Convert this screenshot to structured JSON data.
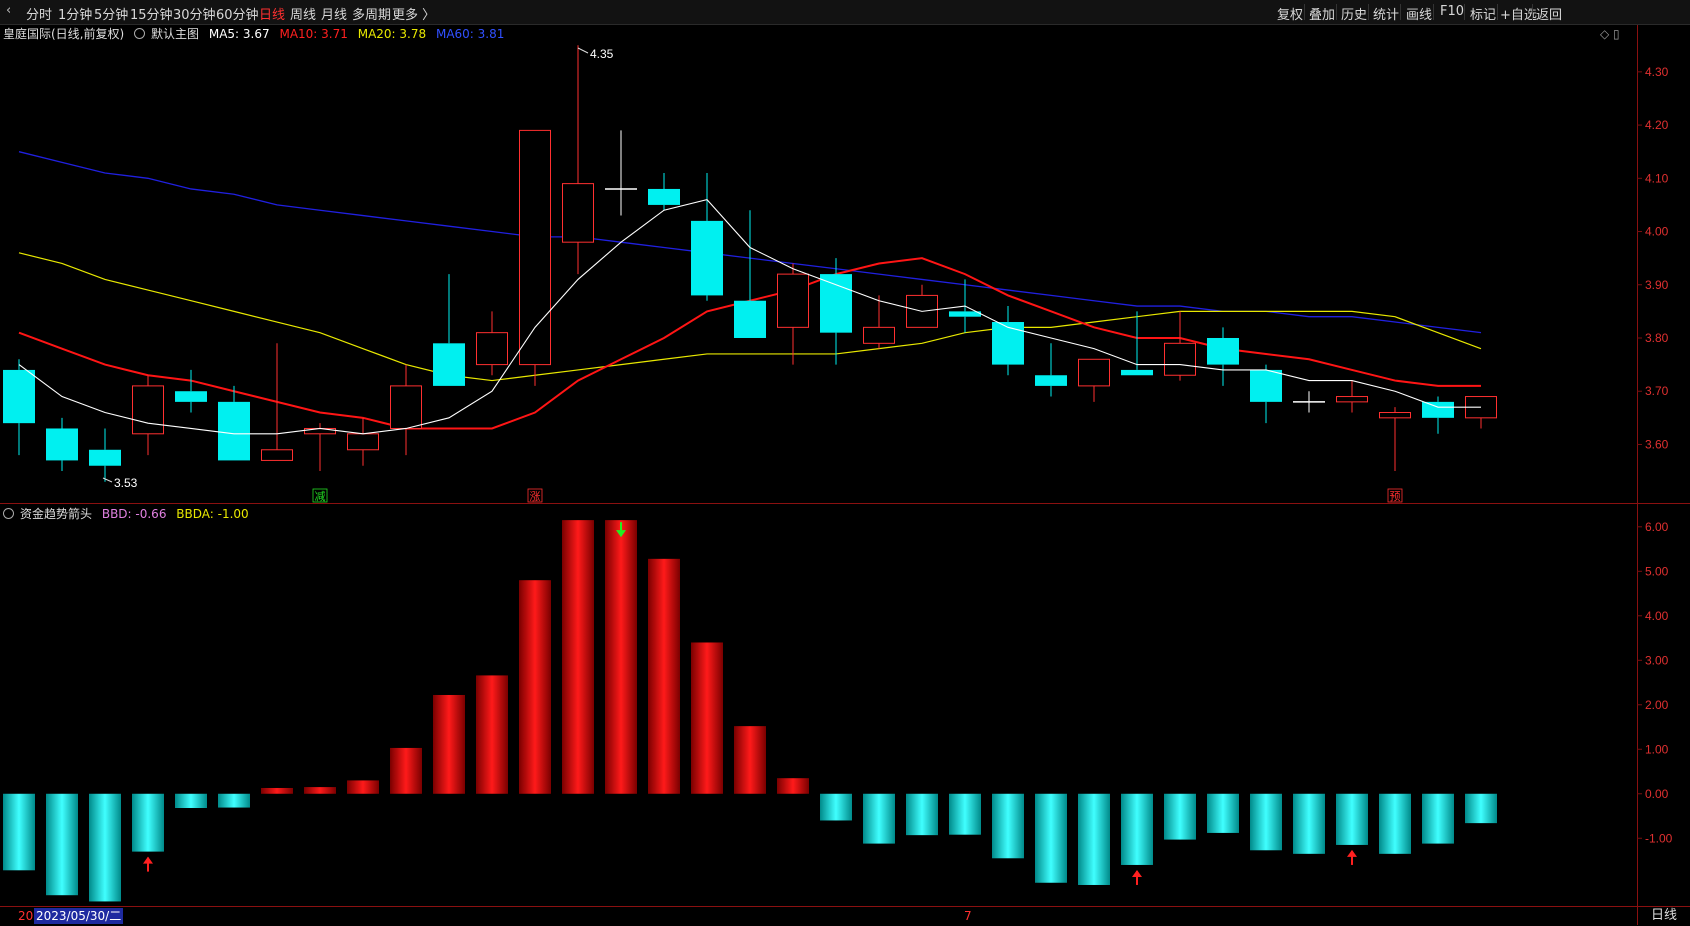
{
  "toolbar": {
    "left": [
      "分时",
      "1分钟",
      "5分钟",
      "15分钟",
      "30分钟",
      "60分钟",
      "日线",
      "周线",
      "月线",
      "多周期",
      "更多 〉"
    ],
    "active_index": 6,
    "right": [
      "复权",
      "叠加",
      "历史",
      "统计",
      "画线",
      "F10",
      "标记",
      "+自选",
      "返回"
    ]
  },
  "main_legend": {
    "title": "皇庭国际(日线,前复权)",
    "template": "默认主图",
    "ma5": "MA5: 3.67",
    "ma10": "MA10: 3.71",
    "ma20": "MA20: 3.78",
    "ma60": "MA60: 3.81"
  },
  "window_icons": "◇ ▯",
  "sub_legend": {
    "name": "资金趋势箭头",
    "bbd": "BBD: -0.66",
    "bbda": "BBDA: -1.00"
  },
  "price_axis": {
    "ticks": [
      "4.30",
      "4.20",
      "4.10",
      "4.00",
      "3.90",
      "3.80",
      "3.70",
      "3.60"
    ],
    "values": [
      4.3,
      4.2,
      4.1,
      4.0,
      3.9,
      3.8,
      3.7,
      3.6
    ],
    "min": 3.49,
    "max": 4.388
  },
  "bbd_axis": {
    "ticks": [
      "6.00",
      "5.00",
      "4.00",
      "3.00",
      "2.00",
      "1.00",
      "0.00",
      "-1.00"
    ],
    "values": [
      6,
      5,
      4,
      3,
      2,
      1,
      0,
      -1
    ],
    "min": -2.5,
    "max": 6.49
  },
  "annotations": {
    "high": "4.35",
    "low": "3.53"
  },
  "signals": [
    {
      "label": "减",
      "index": 7,
      "color": "#22dd22"
    },
    {
      "label": "涨",
      "index": 12,
      "color": "#ff3030"
    },
    {
      "label": "预",
      "index": 32,
      "color": "#ff3030"
    }
  ],
  "chart_data": {
    "type": "candlestick",
    "candles": [
      {
        "o": 3.74,
        "h": 3.76,
        "l": 3.58,
        "c": 3.64
      },
      {
        "o": 3.63,
        "h": 3.65,
        "l": 3.55,
        "c": 3.57
      },
      {
        "o": 3.59,
        "h": 3.63,
        "l": 3.53,
        "c": 3.56
      },
      {
        "o": 3.62,
        "h": 3.73,
        "l": 3.58,
        "c": 3.71
      },
      {
        "o": 3.7,
        "h": 3.74,
        "l": 3.66,
        "c": 3.68
      },
      {
        "o": 3.68,
        "h": 3.71,
        "l": 3.57,
        "c": 3.57
      },
      {
        "o": 3.57,
        "h": 3.79,
        "l": 3.57,
        "c": 3.59
      },
      {
        "o": 3.62,
        "h": 3.64,
        "l": 3.55,
        "c": 3.63
      },
      {
        "o": 3.59,
        "h": 3.65,
        "l": 3.56,
        "c": 3.62
      },
      {
        "o": 3.63,
        "h": 3.75,
        "l": 3.58,
        "c": 3.71
      },
      {
        "o": 3.79,
        "h": 3.92,
        "l": 3.71,
        "c": 3.71
      },
      {
        "o": 3.75,
        "h": 3.85,
        "l": 3.73,
        "c": 3.81
      },
      {
        "o": 3.75,
        "h": 4.19,
        "l": 3.71,
        "c": 4.19
      },
      {
        "o": 3.98,
        "h": 4.35,
        "l": 3.92,
        "c": 4.09
      },
      {
        "o": 4.08,
        "h": 4.19,
        "l": 4.03,
        "c": 4.08
      },
      {
        "o": 4.08,
        "h": 4.11,
        "l": 4.04,
        "c": 4.05
      },
      {
        "o": 4.02,
        "h": 4.11,
        "l": 3.87,
        "c": 3.88
      },
      {
        "o": 3.87,
        "h": 4.04,
        "l": 3.8,
        "c": 3.8
      },
      {
        "o": 3.82,
        "h": 3.94,
        "l": 3.75,
        "c": 3.92
      },
      {
        "o": 3.92,
        "h": 3.95,
        "l": 3.75,
        "c": 3.81
      },
      {
        "o": 3.79,
        "h": 3.88,
        "l": 3.78,
        "c": 3.82
      },
      {
        "o": 3.82,
        "h": 3.9,
        "l": 3.82,
        "c": 3.88
      },
      {
        "o": 3.85,
        "h": 3.91,
        "l": 3.81,
        "c": 3.84
      },
      {
        "o": 3.83,
        "h": 3.86,
        "l": 3.73,
        "c": 3.75
      },
      {
        "o": 3.73,
        "h": 3.79,
        "l": 3.69,
        "c": 3.71
      },
      {
        "o": 3.71,
        "h": 3.76,
        "l": 3.68,
        "c": 3.76
      },
      {
        "o": 3.74,
        "h": 3.85,
        "l": 3.73,
        "c": 3.73
      },
      {
        "o": 3.73,
        "h": 3.85,
        "l": 3.72,
        "c": 3.79
      },
      {
        "o": 3.8,
        "h": 3.82,
        "l": 3.71,
        "c": 3.75
      },
      {
        "o": 3.74,
        "h": 3.75,
        "l": 3.64,
        "c": 3.68
      },
      {
        "o": 3.68,
        "h": 3.7,
        "l": 3.66,
        "c": 3.68
      },
      {
        "o": 3.68,
        "h": 3.72,
        "l": 3.66,
        "c": 3.69
      },
      {
        "o": 3.65,
        "h": 3.67,
        "l": 3.55,
        "c": 3.66
      },
      {
        "o": 3.68,
        "h": 3.69,
        "l": 3.62,
        "c": 3.65
      },
      {
        "o": 3.65,
        "h": 3.69,
        "l": 3.63,
        "c": 3.69
      }
    ],
    "ma5": [
      3.75,
      3.69,
      3.66,
      3.64,
      3.63,
      3.62,
      3.62,
      3.63,
      3.62,
      3.63,
      3.65,
      3.7,
      3.82,
      3.91,
      3.98,
      4.04,
      4.06,
      3.97,
      3.93,
      3.9,
      3.87,
      3.85,
      3.86,
      3.82,
      3.8,
      3.78,
      3.75,
      3.75,
      3.74,
      3.74,
      3.72,
      3.72,
      3.7,
      3.67,
      3.67
    ],
    "ma10": [
      3.81,
      3.78,
      3.75,
      3.73,
      3.72,
      3.7,
      3.68,
      3.66,
      3.65,
      3.63,
      3.63,
      3.63,
      3.66,
      3.72,
      3.76,
      3.8,
      3.85,
      3.87,
      3.89,
      3.92,
      3.94,
      3.95,
      3.92,
      3.88,
      3.85,
      3.82,
      3.8,
      3.8,
      3.78,
      3.77,
      3.76,
      3.74,
      3.72,
      3.71,
      3.71
    ],
    "ma20": [
      3.96,
      3.94,
      3.91,
      3.89,
      3.87,
      3.85,
      3.83,
      3.81,
      3.78,
      3.75,
      3.73,
      3.72,
      3.73,
      3.74,
      3.75,
      3.76,
      3.77,
      3.77,
      3.77,
      3.77,
      3.78,
      3.79,
      3.81,
      3.82,
      3.82,
      3.83,
      3.84,
      3.85,
      3.85,
      3.85,
      3.85,
      3.85,
      3.84,
      3.81,
      3.78
    ],
    "ma60": [
      4.15,
      4.13,
      4.11,
      4.1,
      4.08,
      4.07,
      4.05,
      4.04,
      4.03,
      4.02,
      4.01,
      4.0,
      3.99,
      3.99,
      3.98,
      3.97,
      3.96,
      3.95,
      3.94,
      3.93,
      3.92,
      3.91,
      3.9,
      3.89,
      3.88,
      3.87,
      3.86,
      3.86,
      3.85,
      3.85,
      3.84,
      3.84,
      3.83,
      3.82,
      3.81
    ],
    "bbd": [
      -1.72,
      -2.28,
      -2.42,
      -1.3,
      -0.32,
      -0.31,
      0.13,
      0.15,
      0.3,
      1.03,
      2.22,
      2.66,
      4.8,
      6.15,
      6.15,
      5.28,
      3.4,
      1.52,
      0.35,
      -0.6,
      -1.12,
      -0.93,
      -0.92,
      -1.45,
      -2.0,
      -2.05,
      -1.6,
      -1.03,
      -0.88,
      -1.27,
      -1.35,
      -1.15,
      -1.35,
      -1.12,
      -0.66
    ],
    "arrows": [
      {
        "index": 3,
        "dir": "up",
        "color": "#ff2020"
      },
      {
        "index": 14,
        "dir": "down",
        "color": "#22ee22"
      },
      {
        "index": 26,
        "dir": "up",
        "color": "#ff2020"
      },
      {
        "index": 31,
        "dir": "up",
        "color": "#ff2020"
      }
    ],
    "colors": {
      "up": "#ff3030",
      "down": "#00f0f0",
      "ma5": "#ffffff",
      "ma10": "#ff1515",
      "ma20": "#e8e800",
      "ma60": "#2020e0",
      "grid": "#7a1010"
    }
  },
  "bottom": {
    "date": "2023/05/30/二",
    "left_tick": "20",
    "mid_tick": "7",
    "period": "日线"
  }
}
